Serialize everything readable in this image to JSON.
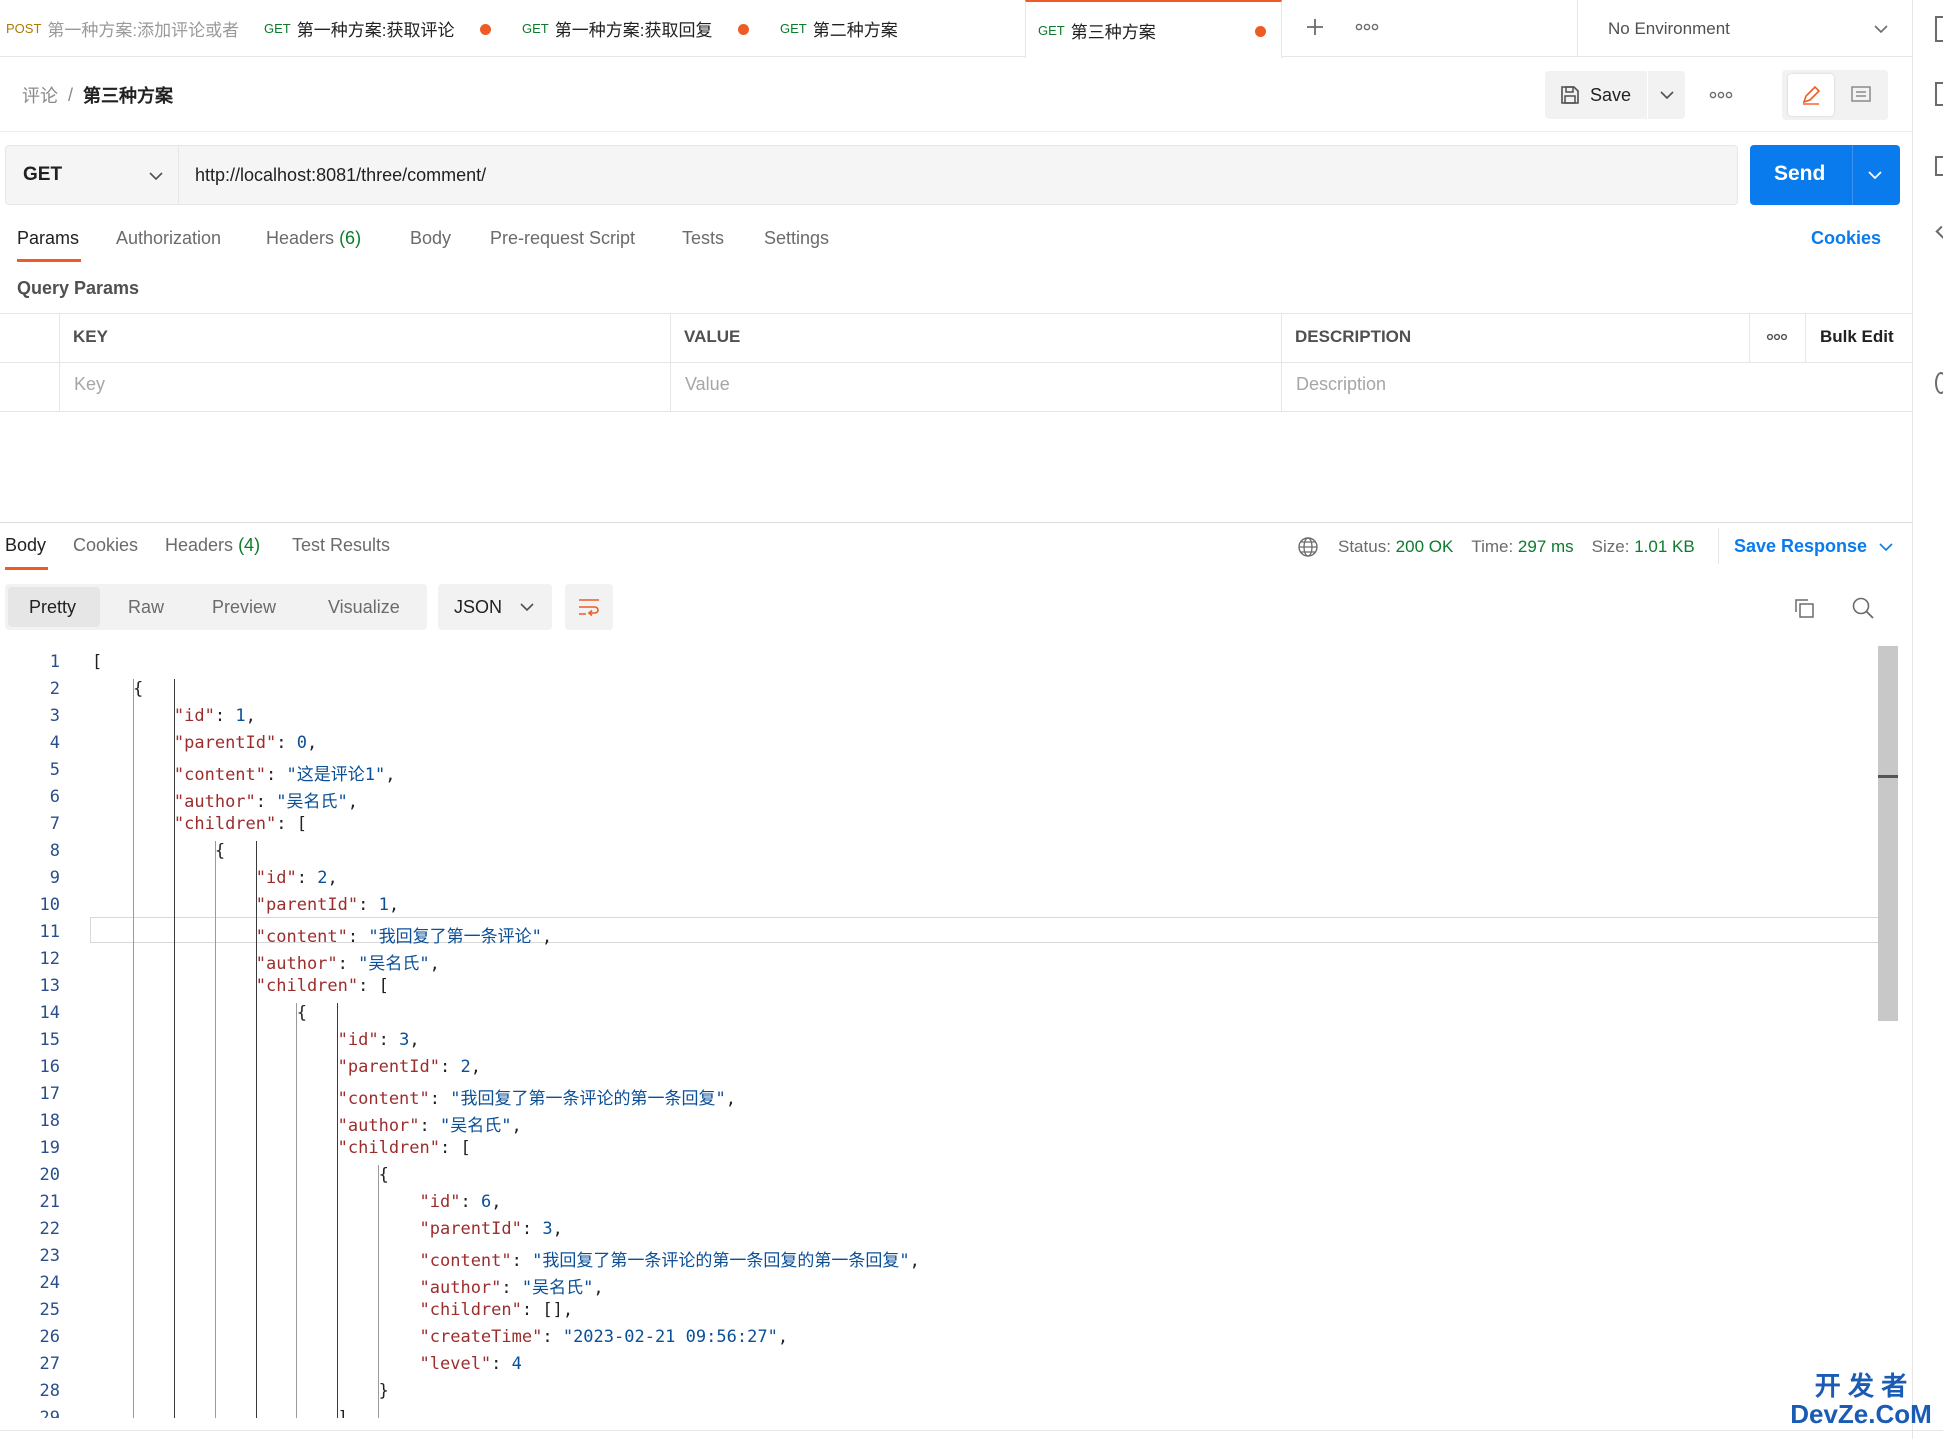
{
  "tabs": [
    {
      "method": "POST",
      "title": "第一种方案:添加评论或者",
      "unsaved": false,
      "active": false
    },
    {
      "method": "GET",
      "title": "第一种方案:获取评论",
      "unsaved": true,
      "active": false
    },
    {
      "method": "GET",
      "title": "第一种方案:获取回复",
      "unsaved": true,
      "active": false
    },
    {
      "method": "GET",
      "title": "第二种方案",
      "unsaved": false,
      "active": false
    },
    {
      "method": "GET",
      "title": "第三种方案",
      "unsaved": true,
      "active": true
    }
  ],
  "environment": "No Environment",
  "breadcrumb": {
    "parent": "评论",
    "separator": "/",
    "current": "第三种方案"
  },
  "header": {
    "save_label": "Save"
  },
  "request": {
    "method": "GET",
    "url": "http://localhost:8081/three/comment/",
    "send_label": "Send"
  },
  "request_tabs": [
    "Params",
    "Authorization",
    "Headers",
    "Body",
    "Pre-request Script",
    "Tests",
    "Settings"
  ],
  "headers_count": "(6)",
  "cookies_link": "Cookies",
  "query_params": {
    "title": "Query Params",
    "columns": [
      "KEY",
      "VALUE",
      "DESCRIPTION"
    ],
    "bulk_edit": "Bulk Edit",
    "placeholders": {
      "key": "Key",
      "value": "Value",
      "description": "Description"
    }
  },
  "response_tabs": [
    "Body",
    "Cookies",
    "Headers",
    "Test Results"
  ],
  "response_headers_count": "(4)",
  "status": {
    "status_label": "Status:",
    "status_value": "200 OK",
    "time_label": "Time:",
    "time_value": "297 ms",
    "size_label": "Size:",
    "size_value": "1.01 KB",
    "save_response": "Save Response"
  },
  "body_modes": [
    "Pretty",
    "Raw",
    "Preview",
    "Visualize"
  ],
  "format": "JSON",
  "code_lines": [
    "[",
    "    {",
    "        \"id\": 1,",
    "        \"parentId\": 0,",
    "        \"content\": \"这是评论1\",",
    "        \"author\": \"吴名氏\",",
    "        \"children\": [",
    "            {",
    "                \"id\": 2,",
    "                \"parentId\": 1,",
    "                \"content\": \"我回复了第一条评论\",",
    "                \"author\": \"吴名氏\",",
    "                \"children\": [",
    "                    {",
    "                        \"id\": 3,",
    "                        \"parentId\": 2,",
    "                        \"content\": \"我回复了第一条评论的第一条回复\",",
    "                        \"author\": \"吴名氏\",",
    "                        \"children\": [",
    "                            {",
    "                                \"id\": 6,",
    "                                \"parentId\": 3,",
    "                                \"content\": \"我回复了第一条评论的第一条回复的第一条回复\",",
    "                                \"author\": \"吴名氏\",",
    "                                \"children\": [],",
    "                                \"createTime\": \"2023-02-21 09:56:27\",",
    "                                \"level\": 4",
    "                            }",
    "                        ]"
  ],
  "watermark": "开 发 者 DevZe.CoM",
  "colors": {
    "accent": "#097bed",
    "tab_active": "#ef5b25",
    "status_ok": "#0b7c2c",
    "json_key": "#9c2d2d",
    "json_value": "#0b4f96"
  }
}
